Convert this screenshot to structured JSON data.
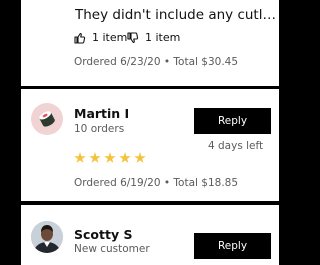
{
  "reviews": [
    {
      "comment": "They didn't include any cutlery, napkins",
      "thumbs_up_label": "1 item",
      "thumbs_down_label": "1 item",
      "ordered_line": "Ordered 6/23/20 • Total $30.45"
    },
    {
      "avatar_icon": "sushi-roll-icon",
      "name": "Martin I",
      "subtitle": "10 orders",
      "reply_label": "Reply",
      "time_ago": "4 days left",
      "rating": 5,
      "rating_color": "#f5c33b",
      "ordered_line": "Ordered 6/19/20 • Total $18.85"
    },
    {
      "avatar_icon": "user-photo",
      "name": "Scotty S",
      "subtitle": "New customer",
      "reply_label": "Reply"
    }
  ]
}
